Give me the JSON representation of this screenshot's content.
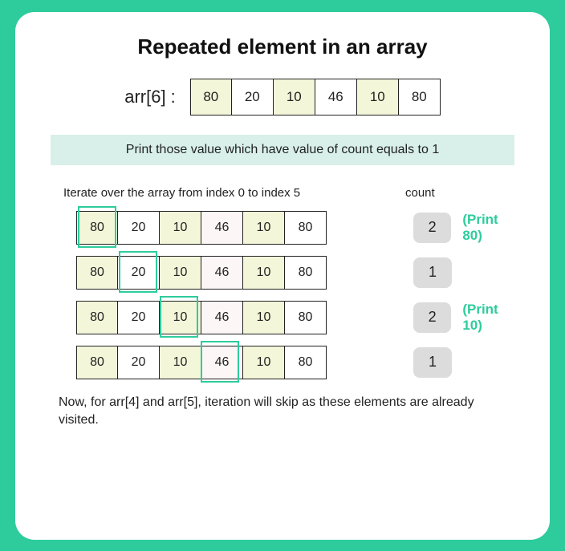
{
  "title": "Repeated element in an array",
  "arr_label": "arr[6] :",
  "top_cells": [
    {
      "v": "80",
      "c": "crm"
    },
    {
      "v": "20",
      "c": ""
    },
    {
      "v": "10",
      "c": "crm"
    },
    {
      "v": "46",
      "c": ""
    },
    {
      "v": "10",
      "c": "crm"
    },
    {
      "v": "80",
      "c": ""
    }
  ],
  "banner": "Print those value which have value of count equals to 1",
  "iterate_label": "Iterate over the array from index 0 to index 5",
  "count_label": "count",
  "rows": [
    {
      "hl": 0,
      "count": "2",
      "print": "(Print 80)",
      "cells": [
        {
          "v": "80",
          "c": "crm"
        },
        {
          "v": "20",
          "c": ""
        },
        {
          "v": "10",
          "c": "crm"
        },
        {
          "v": "46",
          "c": "pnk"
        },
        {
          "v": "10",
          "c": "crm"
        },
        {
          "v": "80",
          "c": ""
        }
      ]
    },
    {
      "hl": 1,
      "count": "1",
      "print": "",
      "cells": [
        {
          "v": "80",
          "c": "crm"
        },
        {
          "v": "20",
          "c": ""
        },
        {
          "v": "10",
          "c": "crm"
        },
        {
          "v": "46",
          "c": "pnk"
        },
        {
          "v": "10",
          "c": "crm"
        },
        {
          "v": "80",
          "c": ""
        }
      ]
    },
    {
      "hl": 2,
      "count": "2",
      "print": "(Print 10)",
      "cells": [
        {
          "v": "80",
          "c": "crm"
        },
        {
          "v": "20",
          "c": ""
        },
        {
          "v": "10",
          "c": "crm"
        },
        {
          "v": "46",
          "c": "pnk"
        },
        {
          "v": "10",
          "c": "crm"
        },
        {
          "v": "80",
          "c": ""
        }
      ]
    },
    {
      "hl": 3,
      "count": "1",
      "print": "",
      "cells": [
        {
          "v": "80",
          "c": "crm"
        },
        {
          "v": "20",
          "c": ""
        },
        {
          "v": "10",
          "c": "crm"
        },
        {
          "v": "46",
          "c": "pnk"
        },
        {
          "v": "10",
          "c": "crm"
        },
        {
          "v": "80",
          "c": ""
        }
      ]
    }
  ],
  "footer": "Now, for arr[4] and arr[5], iteration will skip as these elements are already visited."
}
